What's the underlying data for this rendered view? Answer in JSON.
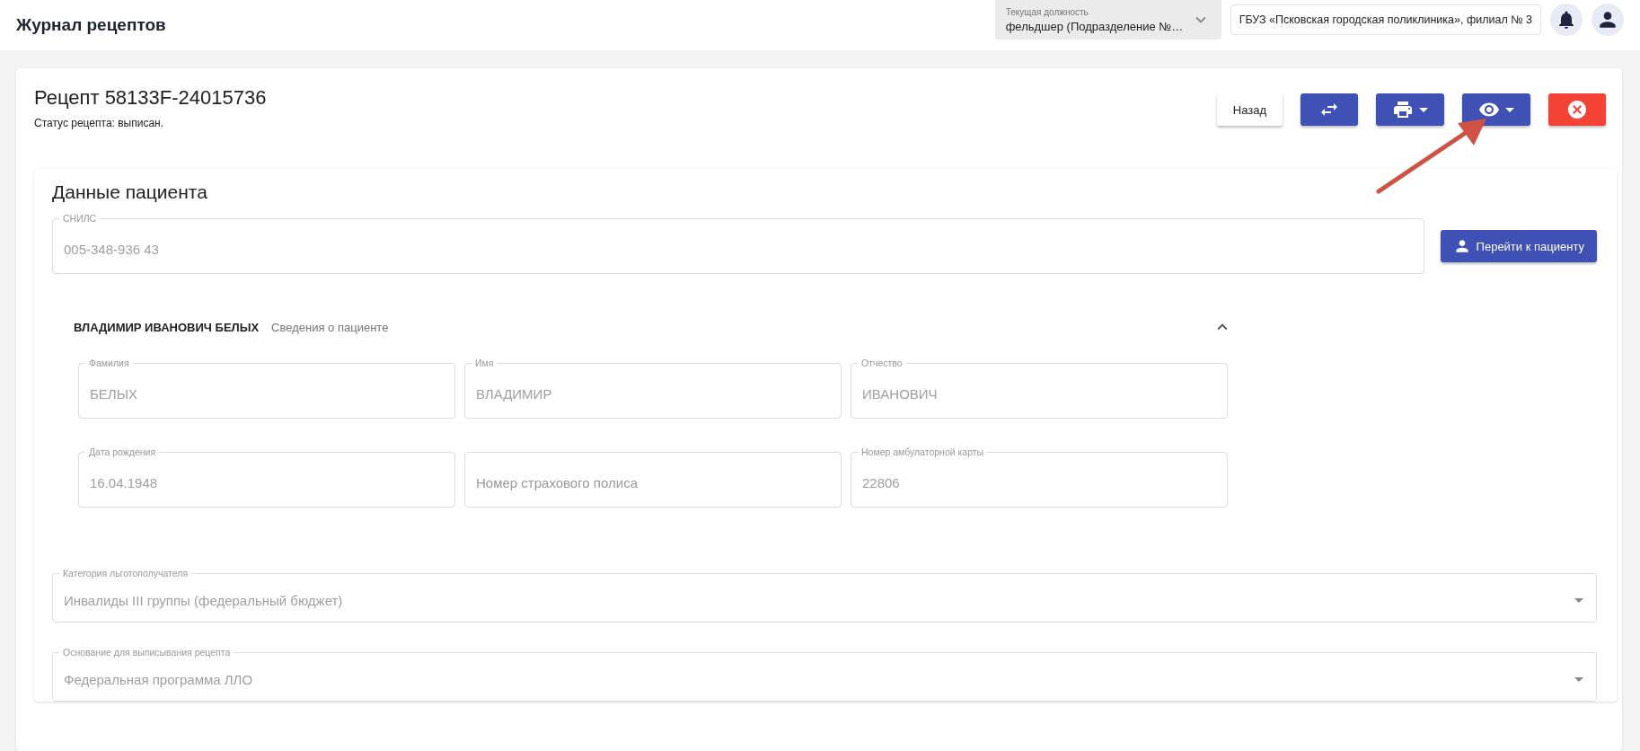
{
  "header": {
    "title": "Журнал рецептов",
    "role": {
      "label": "Текущая должность",
      "value": "фельдшер (Подразделение №…"
    },
    "organization": "ГБУЗ «Псковская городская поликлиника», филиал № 3"
  },
  "prescription": {
    "title": "Рецепт 58133F-24015736",
    "status": "Статус рецепта: выписан.",
    "buttons": [
      {
        "kind": "text",
        "label": "Назад"
      },
      {
        "kind": "swap"
      },
      {
        "kind": "print"
      },
      {
        "kind": "view"
      },
      {
        "kind": "cancel"
      }
    ]
  },
  "patient_section": {
    "title": "Данные пациента",
    "snils": {
      "label": "СНИЛС",
      "value": "005-348-936 43"
    },
    "go_button": "Перейти к пациенту",
    "details": {
      "name": "ВЛАДИМИР ИВАНОВИЧ БЕЛЫХ",
      "subtitle": "Сведения о пациенте",
      "expanded": true,
      "fields": [
        {
          "label": "Фамилия",
          "value": "БЕЛЫХ"
        },
        {
          "label": "Имя",
          "value": "ВЛАДИМИР"
        },
        {
          "label": "Отчество",
          "value": "ИВАНОВИЧ"
        },
        {
          "label": "Дата рождения",
          "value": "16.04.1948"
        },
        {
          "placeholder": "Номер страхового полиса"
        },
        {
          "label": "Номер амбулаторной карты",
          "value": "22806"
        }
      ]
    },
    "selects": [
      {
        "label": "Категория льготополучателя",
        "value": "Инвалиды III группы (федеральный бюджет)"
      },
      {
        "label": "Основание для выписывания рецепта",
        "value": "Федеральная программа ЛЛО"
      }
    ]
  }
}
